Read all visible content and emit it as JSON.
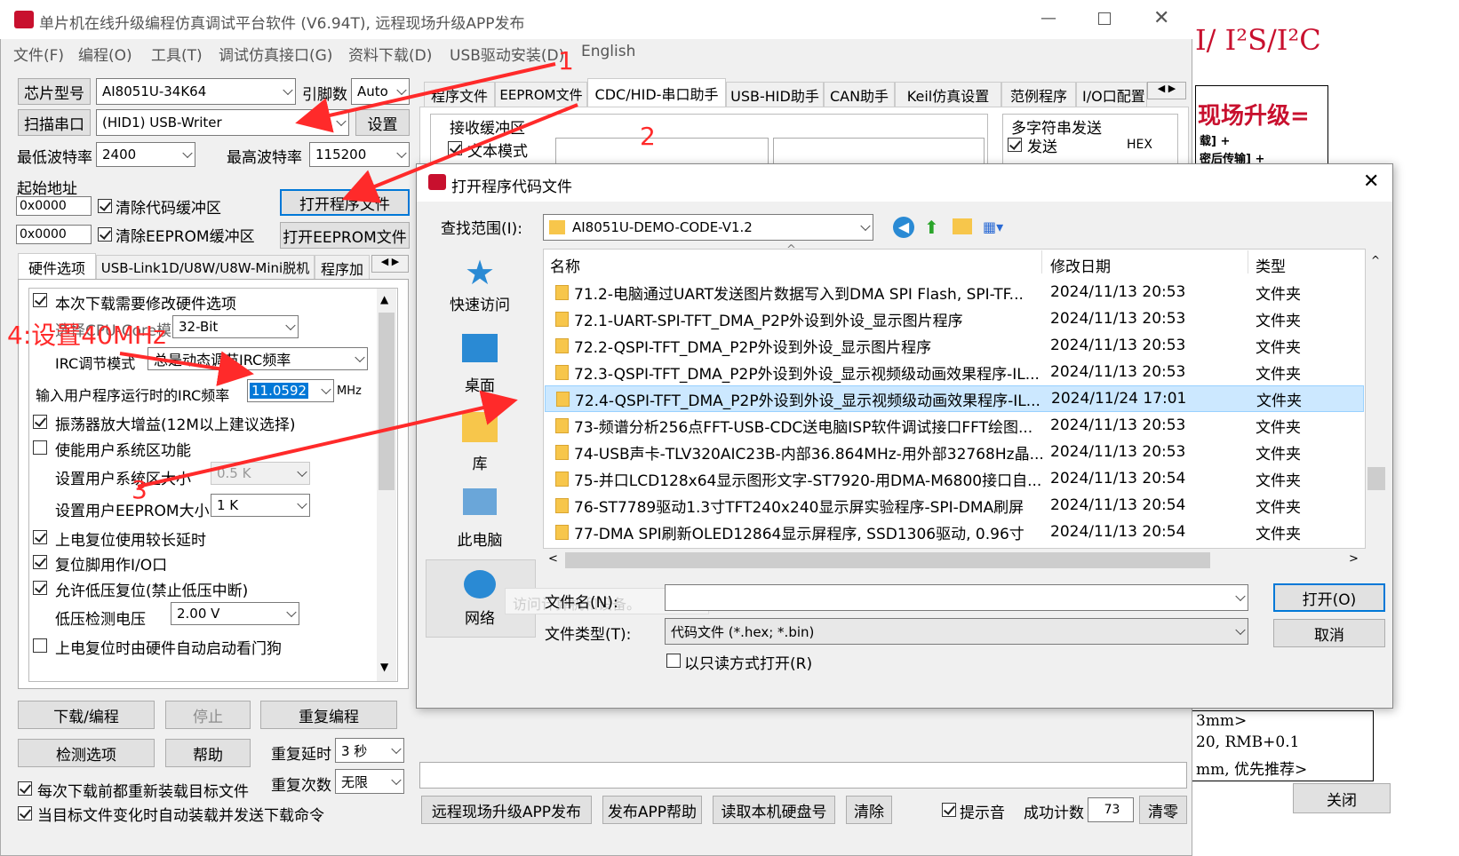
{
  "main_window": {
    "title": "单片机在线升级编程仿真调试平台软件 (V6.94T), 远程现场升级APP发布",
    "menu": [
      "文件(F)",
      "编程(O)",
      "工具(T)",
      "调试仿真接口(G)",
      "资料下载(D)",
      "USB驱动安装(D)",
      "English"
    ],
    "chip_label": "芯片型号",
    "chip_value": "AI8051U-34K64",
    "pin_label": "引脚数",
    "pin_value": "Auto",
    "scan_btn": "扫描串口",
    "port_value": "(HID1) USB-Writer",
    "settings_btn": "设置",
    "min_baud_label": "最低波特率",
    "min_baud": "2400",
    "max_baud_label": "最高波特率",
    "max_baud": "115200",
    "start_addr_label": "起始地址",
    "addr1": "0x0000",
    "addr2": "0x0000",
    "clear_code": "清除代码缓冲区",
    "clear_eeprom": "清除EEPROM缓冲区",
    "open_prog_btn": "打开程序文件",
    "open_eeprom_btn": "打开EEPROM文件",
    "left_tabs": [
      "硬件选项",
      "USB-Link1D/U8W/U8W-Mini脱机",
      "程序加"
    ],
    "hw_opts": {
      "modify": "本次下载需要修改硬件选项",
      "mode_label": "选择CPU-Core模式",
      "mode_value": "32-Bit",
      "irc_mode_label": "IRC调节模式",
      "irc_mode_value": "总是动态调节IRC频率",
      "irc_freq_label": "输入用户程序运行时的IRC频率",
      "irc_freq_value": "11.0592",
      "irc_unit": "MHz",
      "osc_gain": "振荡器放大增益(12M以上建议选择)",
      "user_sys": "使能用户系统区功能",
      "user_sys_size_label": "设置用户系统区大小",
      "user_sys_size": "0.5  K",
      "user_eeprom_label": "设置用户EEPROM大小",
      "user_eeprom": "1    K",
      "long_delay": "上电复位使用较长延时",
      "reset_io": "复位脚用作I/O口",
      "low_volt_reset": "允许低压复位(禁止低压中断)",
      "low_volt_label": "低压检测电压",
      "low_volt": "2.00 V",
      "watchdog": "上电复位时由硬件自动启动看门狗"
    },
    "download_btn": "下载/编程",
    "stop_btn": "停止",
    "reprog_btn": "重复编程",
    "check_btn": "检测选项",
    "help_btn": "帮助",
    "repeat_delay_label": "重复延时",
    "repeat_delay": "3 秒",
    "repeat_count_label": "重复次数",
    "repeat_count": "无限",
    "reload_each": "每次下载前都重新装载目标文件",
    "auto_reload": "当目标文件变化时自动装载并发送下载命令",
    "right_tabs": [
      "程序文件",
      "EEPROM文件",
      "CDC/HID-串口助手",
      "USB-HID助手",
      "CAN助手",
      "Keil仿真设置",
      "范例程序",
      "I/O口配置"
    ],
    "recv_buffer": "接收缓冲区",
    "text_mode": "文本模式",
    "multi_send": "多字符串发送",
    "send": "发送",
    "hex": "HEX",
    "bottom_btns": [
      "远程现场升级APP发布",
      "发布APP帮助",
      "读取本机硬盘号",
      "清除"
    ],
    "beep": "提示音",
    "success_label": "成功计数",
    "success_count": "73",
    "clear_count": "清零"
  },
  "background": {
    "header": "I/ I²S/I²C",
    "upgrade": "现场升级=",
    "line1": "载] +",
    "line2": "密后传输] +",
    "t1": "3mm>",
    "t2": "20, RMB+0.1",
    "t3": "mm, 优先推荐>",
    "close": "关闭"
  },
  "dialog": {
    "title": "打开程序代码文件",
    "lookin_label": "查找范围(I):",
    "lookin_value": "AI8051U-DEMO-CODE-V1.2",
    "places": [
      "快速访问",
      "桌面",
      "库",
      "此电脑",
      "网络"
    ],
    "columns": [
      "名称",
      "修改日期",
      "类型"
    ],
    "files": [
      {
        "name": "71.2-电脑通过UART发送图片数据写入到DMA SPI Flash, SPI-TF...",
        "date": "2024/11/13 20:53",
        "type": "文件夹"
      },
      {
        "name": "72.1-UART-SPI-TFT_DMA_P2P外设到外设_显示图片程序",
        "date": "2024/11/13 20:53",
        "type": "文件夹"
      },
      {
        "name": "72.2-QSPI-TFT_DMA_P2P外设到外设_显示图片程序",
        "date": "2024/11/13 20:53",
        "type": "文件夹"
      },
      {
        "name": "72.3-QSPI-TFT_DMA_P2P外设到外设_显示视频级动画效果程序-IL...",
        "date": "2024/11/13 20:53",
        "type": "文件夹"
      },
      {
        "name": "72.4-QSPI-TFT_DMA_P2P外设到外设_显示视频级动画效果程序-IL...",
        "date": "2024/11/24 17:01",
        "type": "文件夹"
      },
      {
        "name": "73-频谱分析256点FFT-USB-CDC送电脑ISP软件调试接口FFT绘图...",
        "date": "2024/11/13 20:53",
        "type": "文件夹"
      },
      {
        "name": "74-USB声卡-TLV320AIC23B-内部36.864MHz-用外部32768Hz晶...",
        "date": "2024/11/13 20:53",
        "type": "文件夹"
      },
      {
        "name": "75-并口LCD128x64显示图形文字-ST7920-用DMA-M6800接口自...",
        "date": "2024/11/13 20:54",
        "type": "文件夹"
      },
      {
        "name": "76-ST7789驱动1.3寸TFT240x240显示屏实验程序-SPI-DMA刷屏",
        "date": "2024/11/13 20:54",
        "type": "文件夹"
      },
      {
        "name": "77-DMA SPI刷新OLED12864显示屏程序, SSD1306驱动, 0.96寸",
        "date": "2024/11/13 20:54",
        "type": "文件夹"
      }
    ],
    "filename_label": "文件名(N):",
    "filename_value": "",
    "filetype_label": "文件类型(T):",
    "filetype_value": "代码文件 (*.hex; *.bin)",
    "readonly": "以只读方式打开(R)",
    "open_btn": "打开(O)",
    "cancel_btn": "取消",
    "tooltip": "访问计算机和设备。"
  },
  "annotations": {
    "a1": "1",
    "a2": "2",
    "a3": "3",
    "a4": "4:设置40MHz"
  },
  "colors": {
    "annotation": "#ff2a2a",
    "selection": "#cce8ff",
    "focus": "#0078d7",
    "folder": "#f7c64b"
  }
}
